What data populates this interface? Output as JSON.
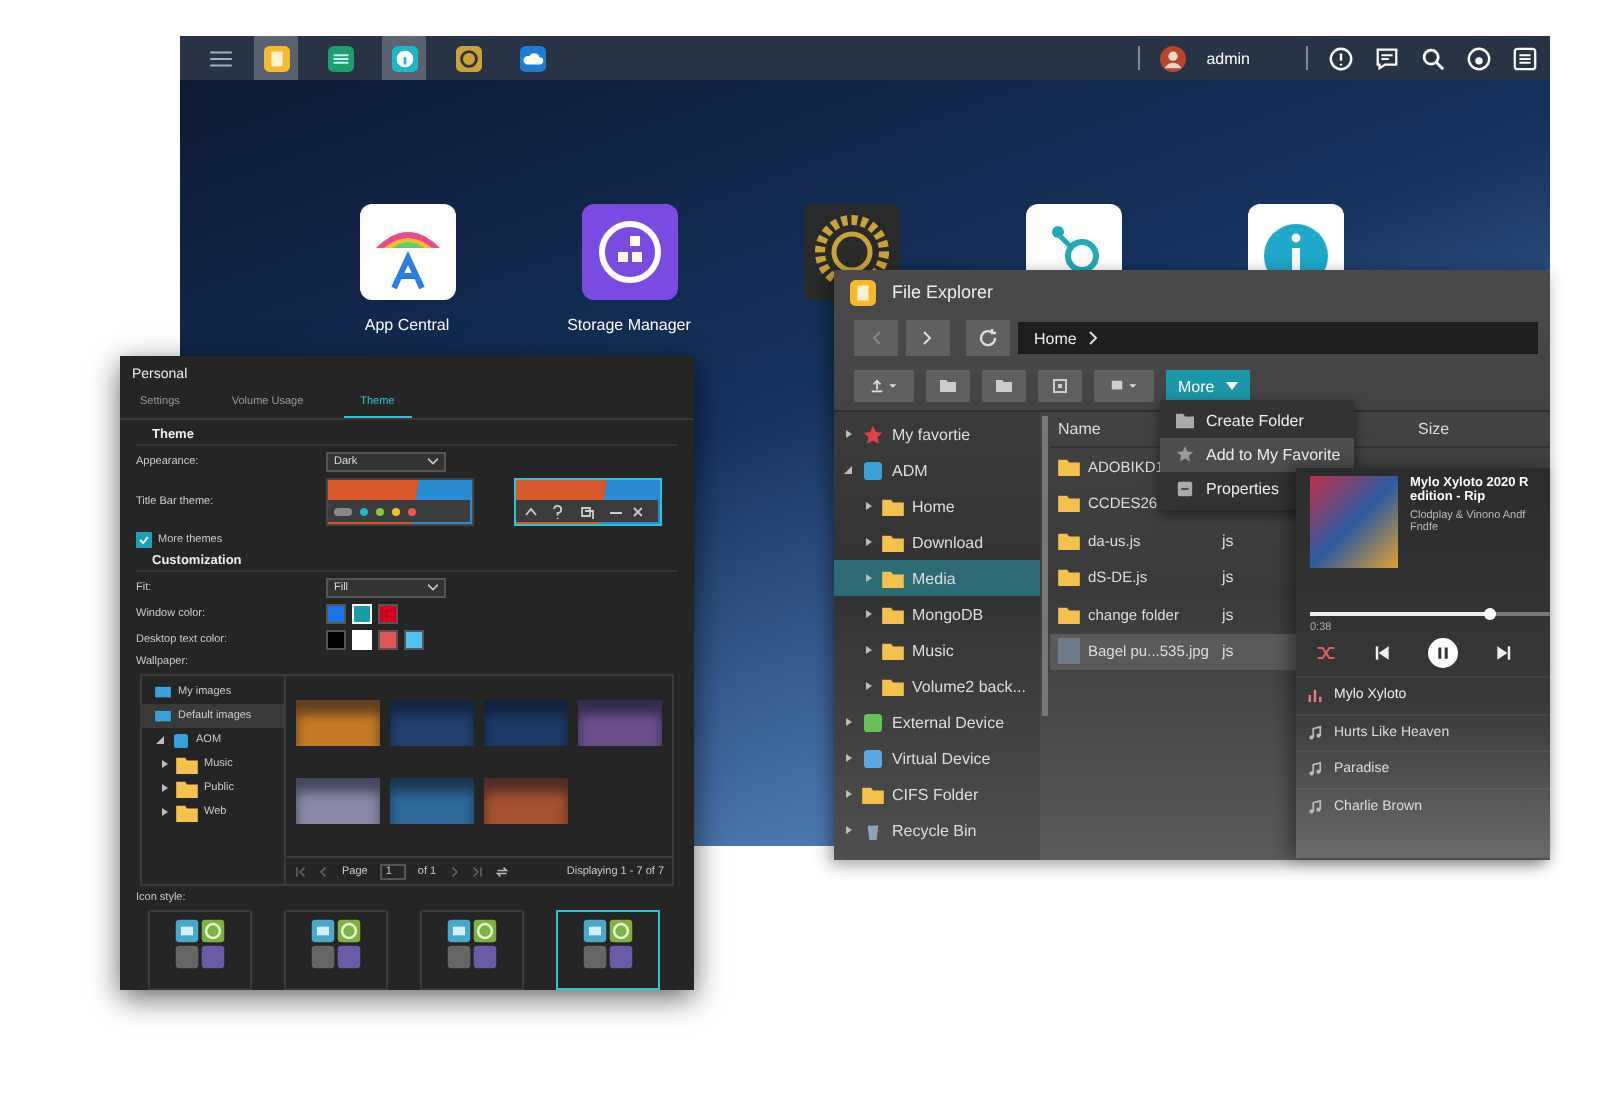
{
  "taskbar": {
    "apps": [
      {
        "kind": "files",
        "selected": true
      },
      {
        "kind": "monitor",
        "selected": false
      },
      {
        "kind": "info",
        "selected": true
      },
      {
        "kind": "settings",
        "selected": false
      },
      {
        "kind": "cloud",
        "selected": false
      }
    ],
    "user": "admin"
  },
  "desktop_icons": [
    {
      "kind": "app-central",
      "label": "App Central"
    },
    {
      "kind": "storage",
      "label": "Storage Manager"
    },
    {
      "kind": "settings"
    },
    {
      "kind": "network"
    },
    {
      "kind": "info"
    }
  ],
  "file_explorer": {
    "title": "File Explorer",
    "path": "Home",
    "more_button": "More",
    "menu": [
      {
        "kind": "folder",
        "label": "Create Folder",
        "selected": false
      },
      {
        "kind": "star",
        "label": "Add to My Favorite",
        "selected": true
      },
      {
        "kind": "properties",
        "label": "Properties",
        "selected": false
      }
    ],
    "tree": [
      {
        "kind": "favorite",
        "label": "My favortie",
        "expanded": false,
        "selected": false
      },
      {
        "kind": "volume",
        "label": "ADM",
        "expanded": true,
        "selected": false,
        "children": [
          {
            "kind": "folder",
            "label": "Home",
            "expanded": false,
            "selected": false
          },
          {
            "kind": "folder",
            "label": "Download",
            "expanded": false,
            "selected": false
          },
          {
            "kind": "folder",
            "label": "Media",
            "expanded": false,
            "selected": true
          },
          {
            "kind": "folder",
            "label": "MongoDB",
            "expanded": false,
            "selected": false
          },
          {
            "kind": "folder",
            "label": "Music",
            "expanded": false,
            "selected": false
          },
          {
            "kind": "folder",
            "label": "Volume2 back...",
            "expanded": false,
            "selected": false
          }
        ]
      },
      {
        "kind": "external",
        "label": "External Device",
        "expanded": false,
        "selected": false
      },
      {
        "kind": "virtual",
        "label": "Virtual Device",
        "expanded": false,
        "selected": false
      },
      {
        "kind": "folder",
        "label": "CIFS Folder",
        "expanded": false,
        "selected": false
      },
      {
        "kind": "recycle",
        "label": "Recycle Bin",
        "expanded": false,
        "selected": false
      }
    ],
    "columns": [
      "Name",
      "Size"
    ],
    "files": [
      {
        "kind": "folder",
        "name": "ADOBIKD1",
        "selected": false
      },
      {
        "kind": "folder",
        "name": "CCDES26",
        "selected": false
      },
      {
        "kind": "folder",
        "name": "da-us.js",
        "type": "js",
        "selected": false
      },
      {
        "kind": "folder",
        "name": "dS-DE.js",
        "type": "js",
        "selected": false
      },
      {
        "kind": "folder",
        "name": "change folder",
        "type": "js",
        "selected": false
      },
      {
        "kind": "image",
        "name": "Bagel pu...535.jpg",
        "type": "js",
        "selected": true
      }
    ]
  },
  "music_player": {
    "title_lines": [
      "Mylo Xyloto 2020 R",
      "edition - Rip"
    ],
    "artist_lines": [
      "Clodplay & Vinono Andf",
      "Fndfe"
    ],
    "elapsed": "0:38",
    "level": 0.75,
    "shuffle": true,
    "playing": true,
    "tracks": [
      {
        "title": "Mylo Xyloto",
        "selected": true
      },
      {
        "title": "Hurts Like Heaven",
        "selected": false
      },
      {
        "title": "Paradise",
        "selected": false
      },
      {
        "title": "Charlie Brown",
        "selected": false
      }
    ]
  },
  "personal": {
    "title": "Personal",
    "tabs": [
      {
        "label": "Settings",
        "selected": false
      },
      {
        "label": "Volume Usage",
        "selected": false
      },
      {
        "label": "Theme",
        "selected": true
      }
    ],
    "theme_heading": "Theme",
    "appearance": {
      "label": "Appearance:",
      "value": "Dark"
    },
    "title_bar_theme": {
      "label": "Title Bar theme:",
      "options": [
        {
          "kind": "dots",
          "selected": false
        },
        {
          "kind": "buttons",
          "selected": true
        }
      ]
    },
    "more_themes": {
      "label": "More themes",
      "checked": true
    },
    "customization_heading": "Customization",
    "fit": {
      "label": "Fit:",
      "value": "Fill"
    },
    "window_color": {
      "label": "Window color:",
      "swatches": [
        {
          "color": "#1a73e8",
          "selected": false
        },
        {
          "color": "#1b9aaa",
          "selected": true
        },
        {
          "color": "#d0021b",
          "selected": false
        }
      ]
    },
    "desktop_text_color": {
      "label": "Desktop text color:",
      "swatches": [
        {
          "color": "#000000",
          "selected": false
        },
        {
          "color": "#ffffff",
          "selected": true
        },
        {
          "color": "#e05555",
          "selected": false
        },
        {
          "color": "#4fc3f7",
          "selected": false
        }
      ]
    },
    "wallpaper": {
      "label": "Wallpaper:",
      "libraries": [
        {
          "label": "My images",
          "selected": false
        },
        {
          "label": "Default images",
          "selected": true
        }
      ],
      "volumes": [
        {
          "label": "AOM",
          "expanded": true,
          "children": [
            {
              "label": "Music",
              "expanded": false
            },
            {
              "label": "Public",
              "expanded": false
            },
            {
              "label": "Web",
              "expanded": false
            }
          ]
        }
      ],
      "images": [
        {
          "color": "#c77a26"
        },
        {
          "color": "#23406e"
        },
        {
          "color": "#1d3a66"
        },
        {
          "color": "#6a4f8a"
        },
        {
          "color": "#8a8aa8"
        },
        {
          "color": "#2f6a9a"
        },
        {
          "color": "#a5522e"
        }
      ],
      "page_label": "Page",
      "page": "1",
      "page_total": "of 1",
      "displaying": "Displaying 1 - 7 of 7"
    },
    "icon_style": {
      "label": "Icon style:",
      "options": [
        {
          "selected": false
        },
        {
          "selected": false
        },
        {
          "selected": false
        },
        {
          "selected": true
        }
      ]
    }
  }
}
